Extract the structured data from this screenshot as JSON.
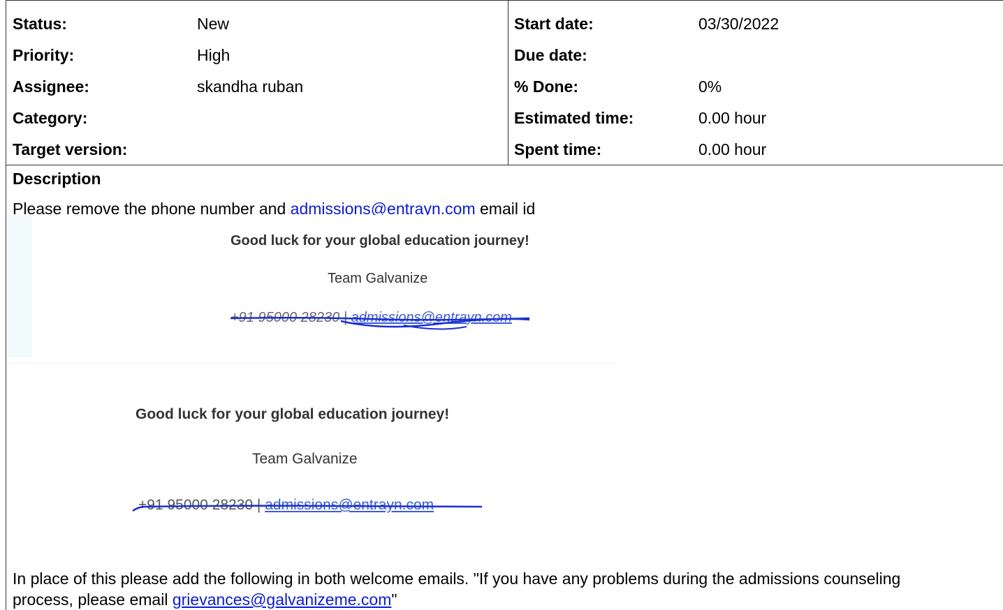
{
  "attributes": {
    "left": [
      {
        "label": "Status:",
        "value": "New"
      },
      {
        "label": "Priority:",
        "value": "High"
      },
      {
        "label": "Assignee:",
        "value": "skandha ruban"
      },
      {
        "label": "Category:",
        "value": ""
      },
      {
        "label": "Target version:",
        "value": ""
      }
    ],
    "right": [
      {
        "label": "Start date:",
        "value": "03/30/2022"
      },
      {
        "label": "Due date:",
        "value": ""
      },
      {
        "label": "% Done:",
        "value": "0%"
      },
      {
        "label": "Estimated time:",
        "value": "0.00 hour"
      },
      {
        "label": "Spent time:",
        "value": "0.00 hour"
      }
    ]
  },
  "description": {
    "heading": "Description",
    "line1_before": "Please remove the phone number and ",
    "line1_link": "admissions@entrayn.com",
    "line1_after": " email id",
    "image1": {
      "title": "Good luck for your global education journey!",
      "team": "Team Galvanize",
      "phone": "+91 95000 28230 | ",
      "email": "admissions@entrayn.com"
    },
    "image2": {
      "title": "Good luck for your global education journey!",
      "team": "Team Galvanize",
      "phone": "+91 95000 28230 | ",
      "email": "admissions@entrayn.com"
    },
    "closing_line1": "In place of this please add the following in both welcome emails. \"If you have any problems during the admissions counseling",
    "closing_line2_before": "process, please email ",
    "closing_link": "grievances@galvanizeme.com",
    "closing_line2_after": "\""
  },
  "colors": {
    "link": "#0a1bd6",
    "scribble": "#1a2fd0"
  }
}
